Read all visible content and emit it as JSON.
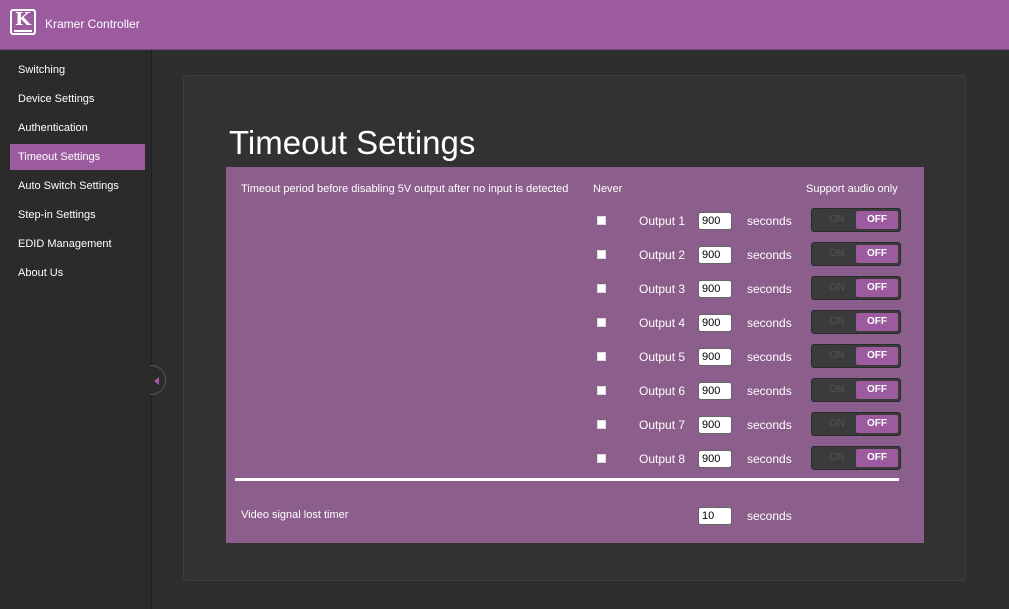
{
  "header": {
    "app_title": "Kramer Controller",
    "logo_letter": "K"
  },
  "sidebar": {
    "items": [
      {
        "label": "Switching"
      },
      {
        "label": "Device Settings"
      },
      {
        "label": "Authentication"
      },
      {
        "label": "Timeout Settings"
      },
      {
        "label": "Auto Switch Settings"
      },
      {
        "label": "Step-in Settings"
      },
      {
        "label": "EDID Management"
      },
      {
        "label": "About Us"
      }
    ],
    "active_index": 3
  },
  "page": {
    "title": "Timeout Settings"
  },
  "panel": {
    "description": "Timeout period before disabling 5V output after no input is detected",
    "never_header": "Never",
    "support_audio_header": "Support audio only",
    "unit": "seconds",
    "toggle_on": "ON",
    "toggle_off": "OFF",
    "outputs": [
      {
        "label": "Output 1",
        "value": "900",
        "never": false,
        "audio_only": "OFF"
      },
      {
        "label": "Output 2",
        "value": "900",
        "never": false,
        "audio_only": "OFF"
      },
      {
        "label": "Output 3",
        "value": "900",
        "never": false,
        "audio_only": "OFF"
      },
      {
        "label": "Output 4",
        "value": "900",
        "never": false,
        "audio_only": "OFF"
      },
      {
        "label": "Output 5",
        "value": "900",
        "never": false,
        "audio_only": "OFF"
      },
      {
        "label": "Output 6",
        "value": "900",
        "never": false,
        "audio_only": "OFF"
      },
      {
        "label": "Output 7",
        "value": "900",
        "never": false,
        "audio_only": "OFF"
      },
      {
        "label": "Output 8",
        "value": "900",
        "never": false,
        "audio_only": "OFF"
      }
    ],
    "video_lost": {
      "label": "Video signal lost timer",
      "value": "10",
      "unit": "seconds"
    }
  },
  "colors": {
    "accent": "#9b5b9e",
    "panel": "#8c5e8c",
    "background": "#2e2e2e"
  }
}
